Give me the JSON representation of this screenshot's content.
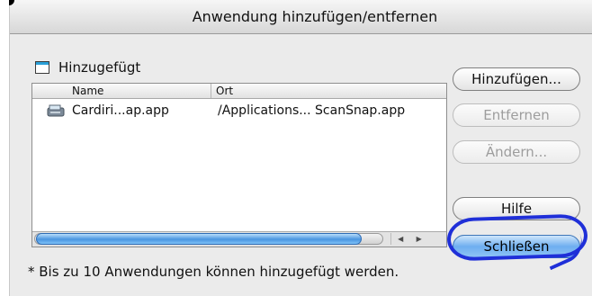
{
  "window": {
    "title": "Anwendung hinzufügen/entfernen"
  },
  "section": {
    "label": "Hinzugefügt",
    "icon": "window-icon"
  },
  "list": {
    "columns": [
      "Name",
      "Ort"
    ],
    "rows": [
      {
        "icon": "scanner-app-icon",
        "name": "Cardiri...ap.app",
        "location": "/Applications... ScanSnap.app"
      }
    ],
    "scroll": {
      "left_arrow": "◀",
      "right_arrow": "▶"
    }
  },
  "buttons": {
    "add": "Hinzufügen...",
    "remove": "Entfernen",
    "change": "Ändern...",
    "help": "Hilfe",
    "close": "Schließen"
  },
  "footer": {
    "note": "* Bis zu 10 Anwendungen können hinzugefügt werden."
  },
  "colors": {
    "accent": "#4a95e0",
    "annotation": "#1f2fd8"
  }
}
